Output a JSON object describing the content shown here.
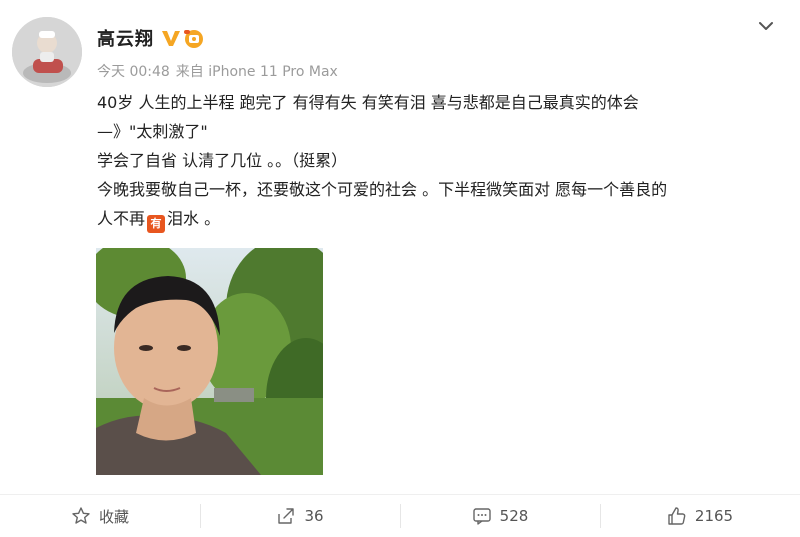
{
  "post": {
    "username": "高云翔",
    "badge_icon": "vip-verified-icon",
    "timestamp": "今天 00:48",
    "source": "来自 iPhone 11 Pro Max",
    "content_lines": [
      "40岁 人生的上半程 跑完了 有得有失 有笑有泪 喜与悲都是自己最真实的体会",
      "—》\"太刺激了\"",
      "学会了自省 认清了几位 。。（挺累）",
      "今晚我要敬自己一杯，还要敬这个可爱的社会 。下半程微笑面对 愿每一个善良的",
      "人不再",
      "泪水 。"
    ],
    "inline_emoji_label": "有"
  },
  "actions": {
    "favorite_label": "收藏",
    "repost_count": "36",
    "comment_count": "528",
    "like_count": "2165"
  },
  "colors": {
    "accent_orange": "#f5a623",
    "text_primary": "#222222",
    "text_meta": "#9b9b9b"
  }
}
